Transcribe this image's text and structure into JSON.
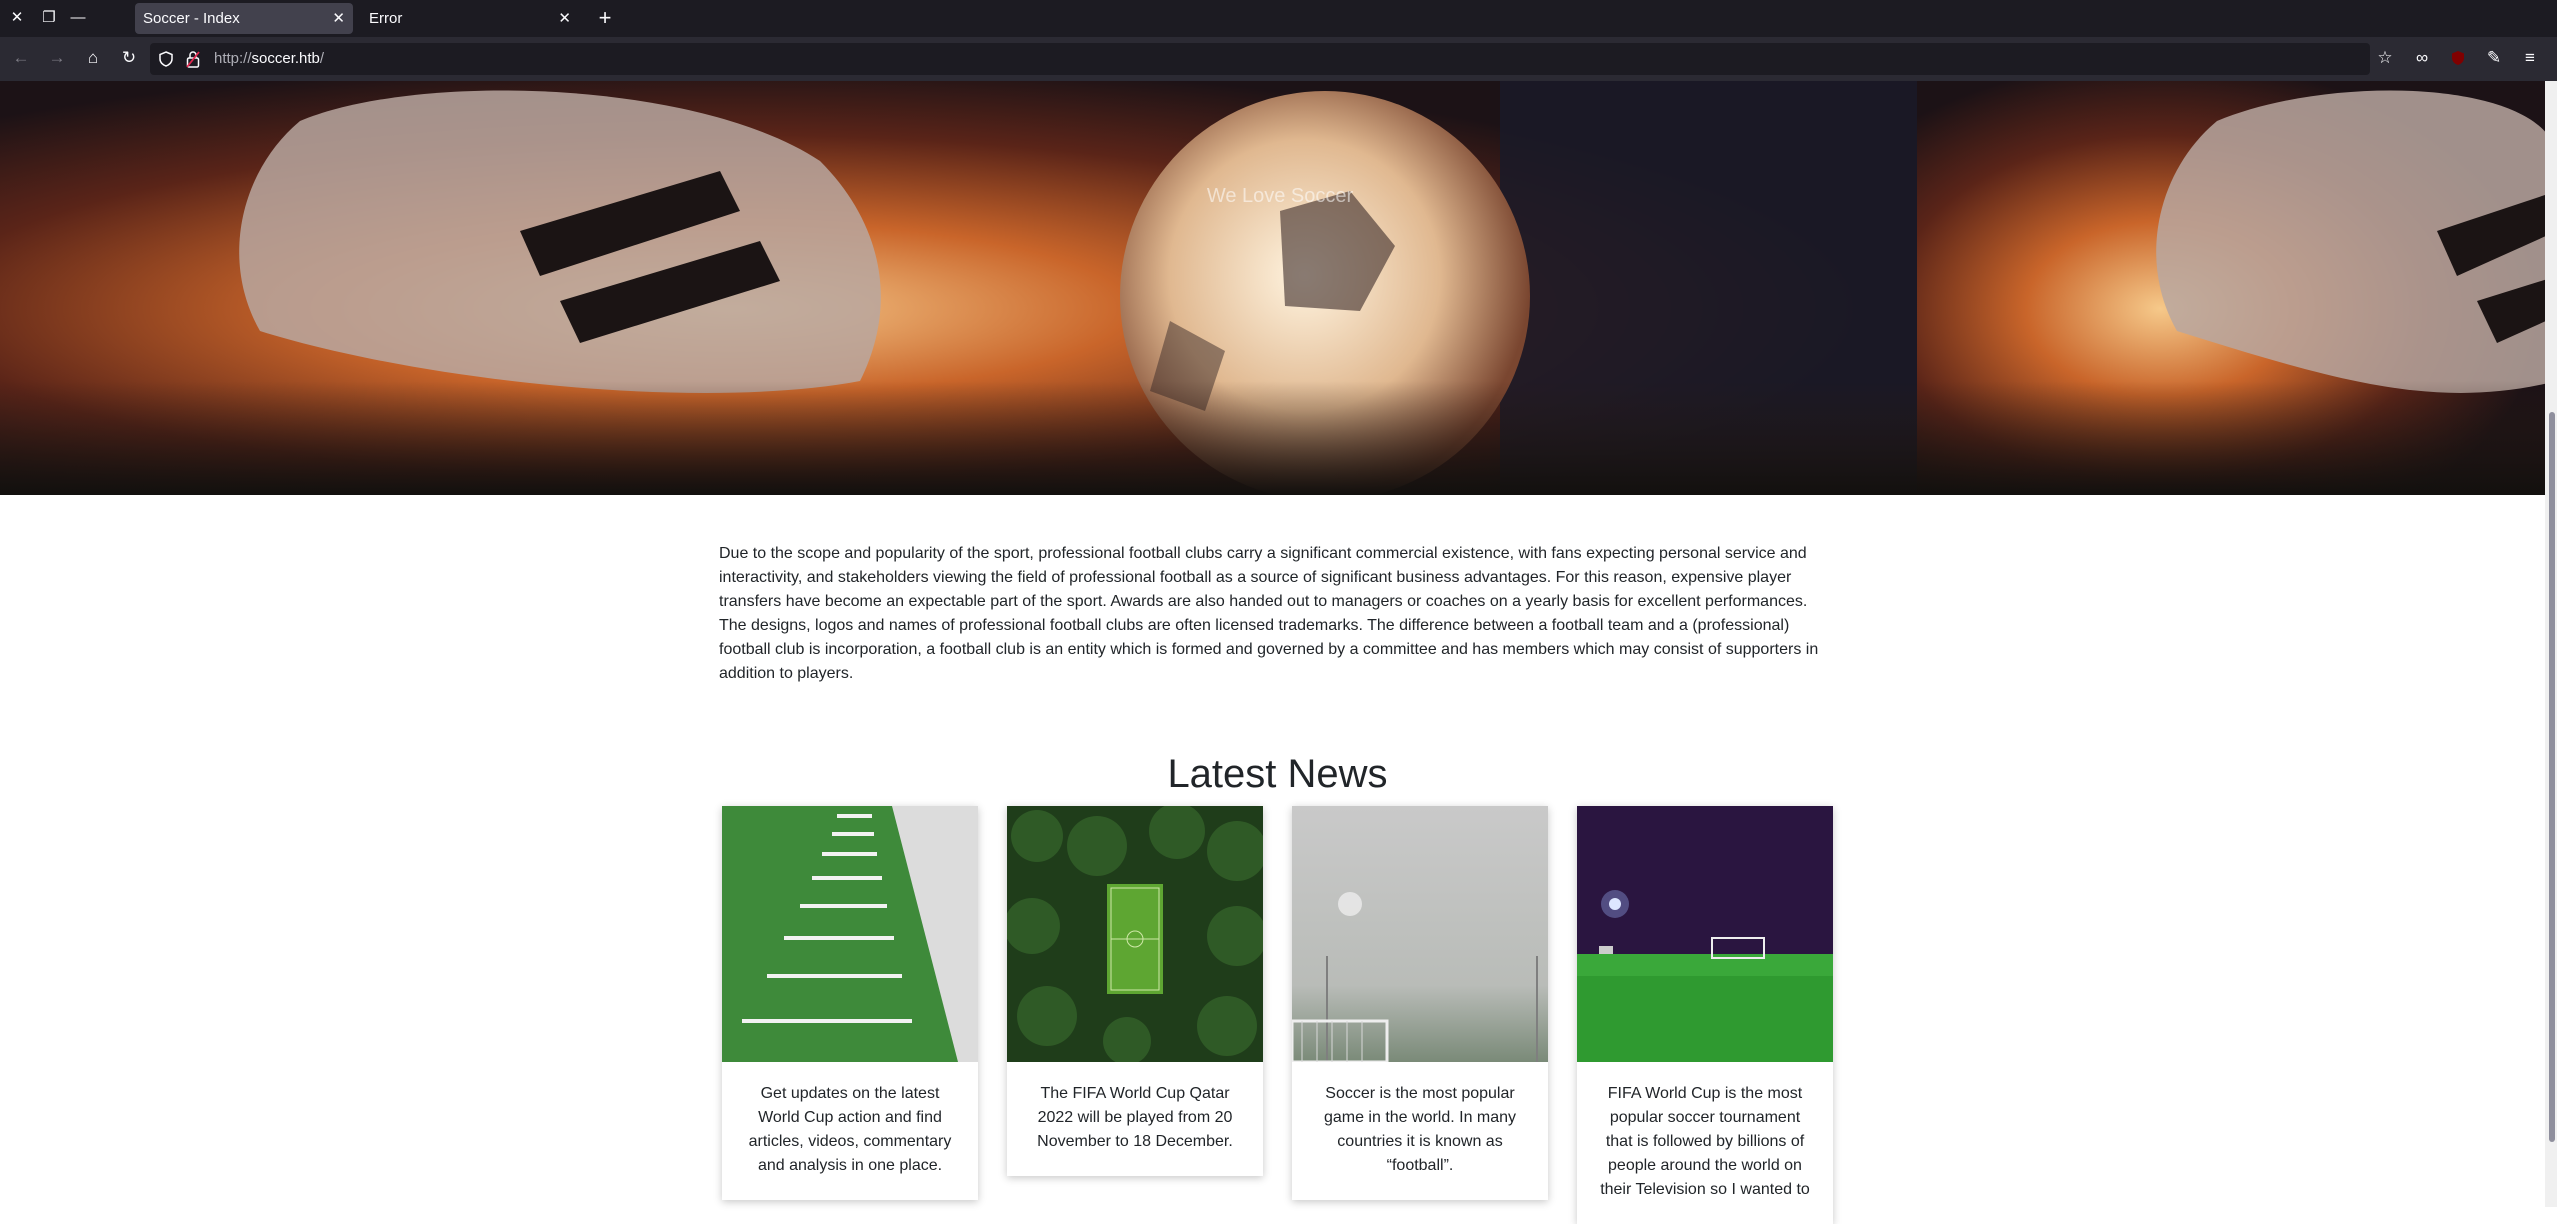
{
  "browser": {
    "tabs": [
      {
        "title": "Soccer - Index",
        "active": true
      },
      {
        "title": "Error",
        "active": false
      }
    ],
    "address": {
      "protocol": "http://",
      "host": "soccer.htb",
      "path": "/"
    }
  },
  "hero": {
    "title": "We Love Soccer"
  },
  "intro": {
    "text": "Due to the scope and popularity of the sport, professional football clubs carry a significant commercial existence, with fans expecting personal service and interactivity, and stakeholders viewing the field of professional football as a source of significant business advantages. For this reason, expensive player transfers have become an expectable part of the sport. Awards are also handed out to managers or coaches on a yearly basis for excellent performances. The designs, logos and names of professional football clubs are often licensed trademarks. The difference between a football team and a (professional) football club is incorporation, a football club is an entity which is formed and governed by a committee and has members which may consist of supporters in addition to players."
  },
  "news": {
    "heading": "Latest News",
    "cards": [
      {
        "text": "Get updates on the latest World Cup action and find articles, videos, commentary and analysis in one place."
      },
      {
        "text": "The FIFA World Cup Qatar 2022 will be played from 20 November to 18 December."
      },
      {
        "text": "Soccer is the most popular game in the world. In many countries it is known as “football”."
      },
      {
        "text": "FIFA World Cup is the most popular soccer tournament that is followed by billions of people around the world on their Television so I wanted to"
      }
    ]
  },
  "colors": {
    "tabbar": "#1c1b22",
    "navbar": "#2b2a33",
    "text": "#212529"
  }
}
